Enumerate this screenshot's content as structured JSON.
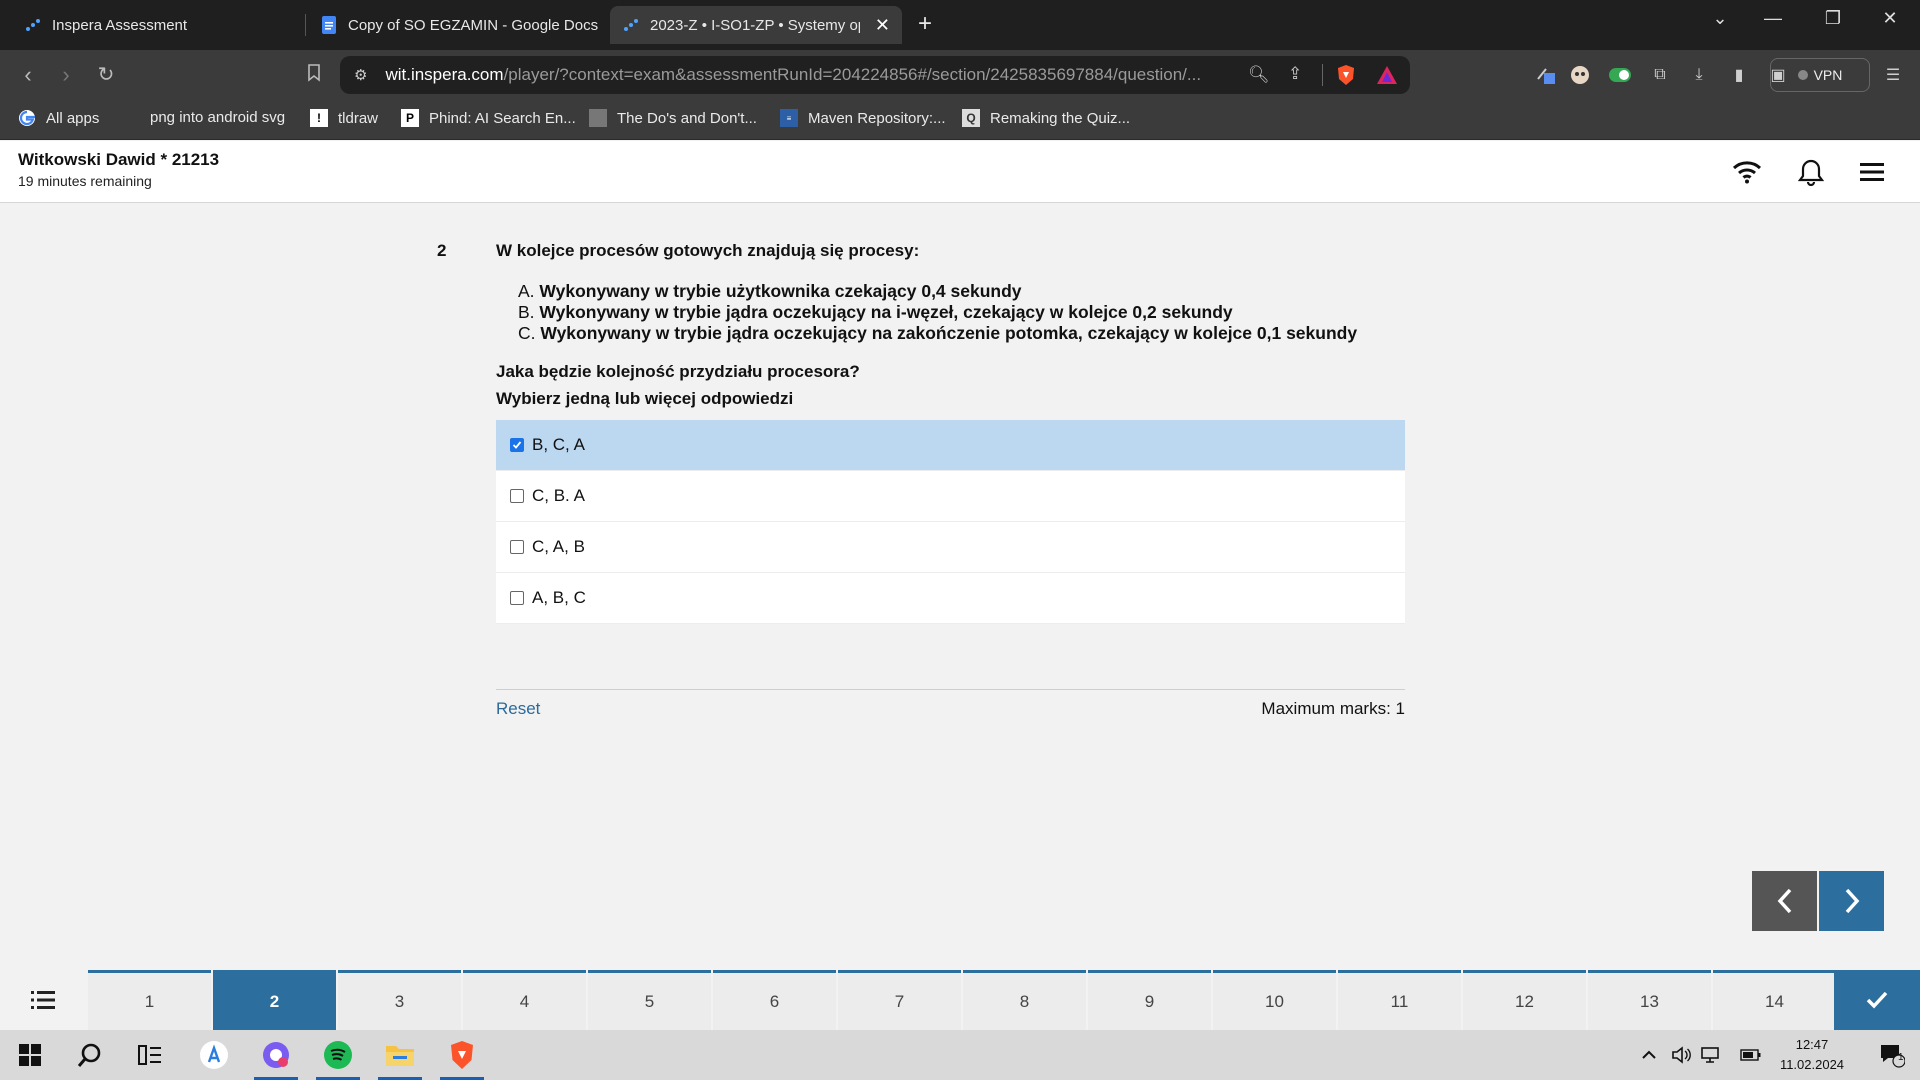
{
  "browser": {
    "tabs": [
      {
        "title": "Inspera Assessment",
        "active": false
      },
      {
        "title": "Copy of SO EGZAMIN - Google Docs",
        "active": false
      },
      {
        "title": "2023-Z • I-SO1-ZP • Systemy op",
        "active": true
      }
    ],
    "url_host": "wit.inspera.com",
    "url_path": "/player/?context=exam&assessmentRunId=204224856#/section/2425835697884/question/...",
    "vpn_label": "VPN",
    "bookmarks": [
      "All apps",
      "png into android svg",
      "tldraw",
      "Phind: AI Search En...",
      "The Do's and Don't...",
      "Maven Repository:...",
      "Remaking the Quiz..."
    ]
  },
  "header": {
    "candidate": "Witkowski Dawid * 21213",
    "time_remaining": "19 minutes remaining"
  },
  "question": {
    "number": "2",
    "stem": "W kolejce procesów gotowych znajdują się procesy:",
    "items": [
      {
        "letter": "A.",
        "text": "Wykonywany w trybie użytkownika czekający 0,4 sekundy"
      },
      {
        "letter": "B.",
        "text": "Wykonywany w trybie jądra oczekujący na i-węzeł, czekający w kolejce 0,2 sekundy"
      },
      {
        "letter": "C.",
        "text": "Wykonywany w trybie jądra oczekujący na zakończenie potomka, czekający w kolejce 0,1 sekundy"
      }
    ],
    "ask": "Jaka będzie kolejność przydziału procesora?",
    "instruction": "Wybierz jedną lub więcej odpowiedzi",
    "options": [
      {
        "label": "B, C, A",
        "checked": true
      },
      {
        "label": "C, B. A",
        "checked": false
      },
      {
        "label": "C, A, B",
        "checked": false
      },
      {
        "label": "A, B, C",
        "checked": false
      }
    ],
    "reset_label": "Reset",
    "max_marks": "Maximum marks: 1"
  },
  "navigation": {
    "questions": [
      "1",
      "2",
      "3",
      "4",
      "5",
      "6",
      "7",
      "8",
      "9",
      "10",
      "11",
      "12",
      "13",
      "14"
    ],
    "current": "2"
  },
  "taskbar": {
    "time": "12:47",
    "date": "11.02.2024",
    "notification_count": "1"
  },
  "colors": {
    "accent": "#2c6e9e",
    "selected_option": "#bcd7f0",
    "link": "#2b6a9b"
  }
}
